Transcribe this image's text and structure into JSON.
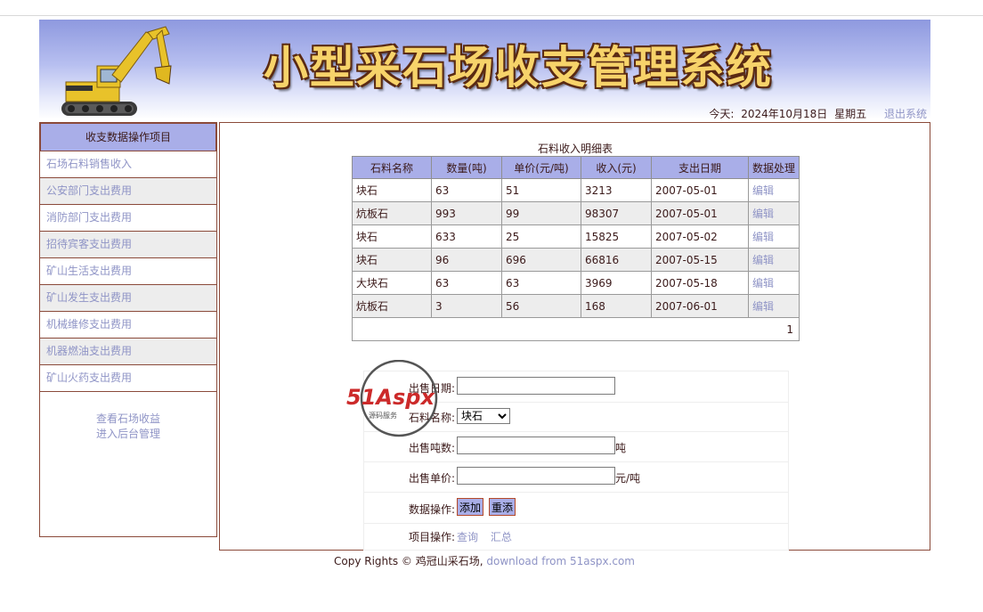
{
  "header": {
    "title": "小型采石场收支管理系统",
    "today_label": "今天:",
    "date": "2024年10月18日",
    "weekday": "星期五",
    "logout": "退出系统"
  },
  "sidebar": {
    "heading": "收支数据操作项目",
    "items": [
      {
        "label": "石场石料销售收入"
      },
      {
        "label": "公安部门支出费用"
      },
      {
        "label": "消防部门支出费用"
      },
      {
        "label": "招待宾客支出费用"
      },
      {
        "label": "矿山生活支出费用"
      },
      {
        "label": "矿山发生支出费用"
      },
      {
        "label": "机械维修支出费用"
      },
      {
        "label": "机器燃油支出费用"
      },
      {
        "label": "矿山火药支出费用"
      }
    ],
    "links": [
      "查看石场收益",
      "进入后台管理"
    ]
  },
  "table": {
    "caption": "石料收入明细表",
    "columns": [
      "石料名称",
      "数量(吨)",
      "单价(元/吨)",
      "收入(元)",
      "支出日期",
      "数据处理"
    ],
    "rows": [
      [
        "块石",
        "63",
        "51",
        "3213",
        "2007-05-01",
        "编辑"
      ],
      [
        "炕板石",
        "993",
        "99",
        "98307",
        "2007-05-01",
        "编辑"
      ],
      [
        "块石",
        "633",
        "25",
        "15825",
        "2007-05-02",
        "编辑"
      ],
      [
        "块石",
        "96",
        "696",
        "66816",
        "2007-05-15",
        "编辑"
      ],
      [
        "大块石",
        "63",
        "63",
        "3969",
        "2007-05-18",
        "编辑"
      ],
      [
        "炕板石",
        "3",
        "56",
        "168",
        "2007-06-01",
        "编辑"
      ]
    ],
    "page": "1"
  },
  "form": {
    "date_label": "出售日期:",
    "date_value": "",
    "stone_label": "石料名称:",
    "stone_selected": "块石",
    "tons_label": "出售吨数:",
    "tons_value": "",
    "tons_unit": "吨",
    "price_label": "出售单价:",
    "price_value": "",
    "price_unit": "元/吨",
    "ops_label": "数据操作:",
    "add_button": "添加",
    "reset_button": "重添",
    "proj_label": "项目操作:",
    "query_link": "查询",
    "summary_link": "汇总"
  },
  "watermark": {
    "brand": "51Aspx",
    "sub": "源码服务"
  },
  "footer": {
    "copyright": "Copy Rights © 鸡冠山采石场,",
    "download": "download from 51aspx.com"
  }
}
